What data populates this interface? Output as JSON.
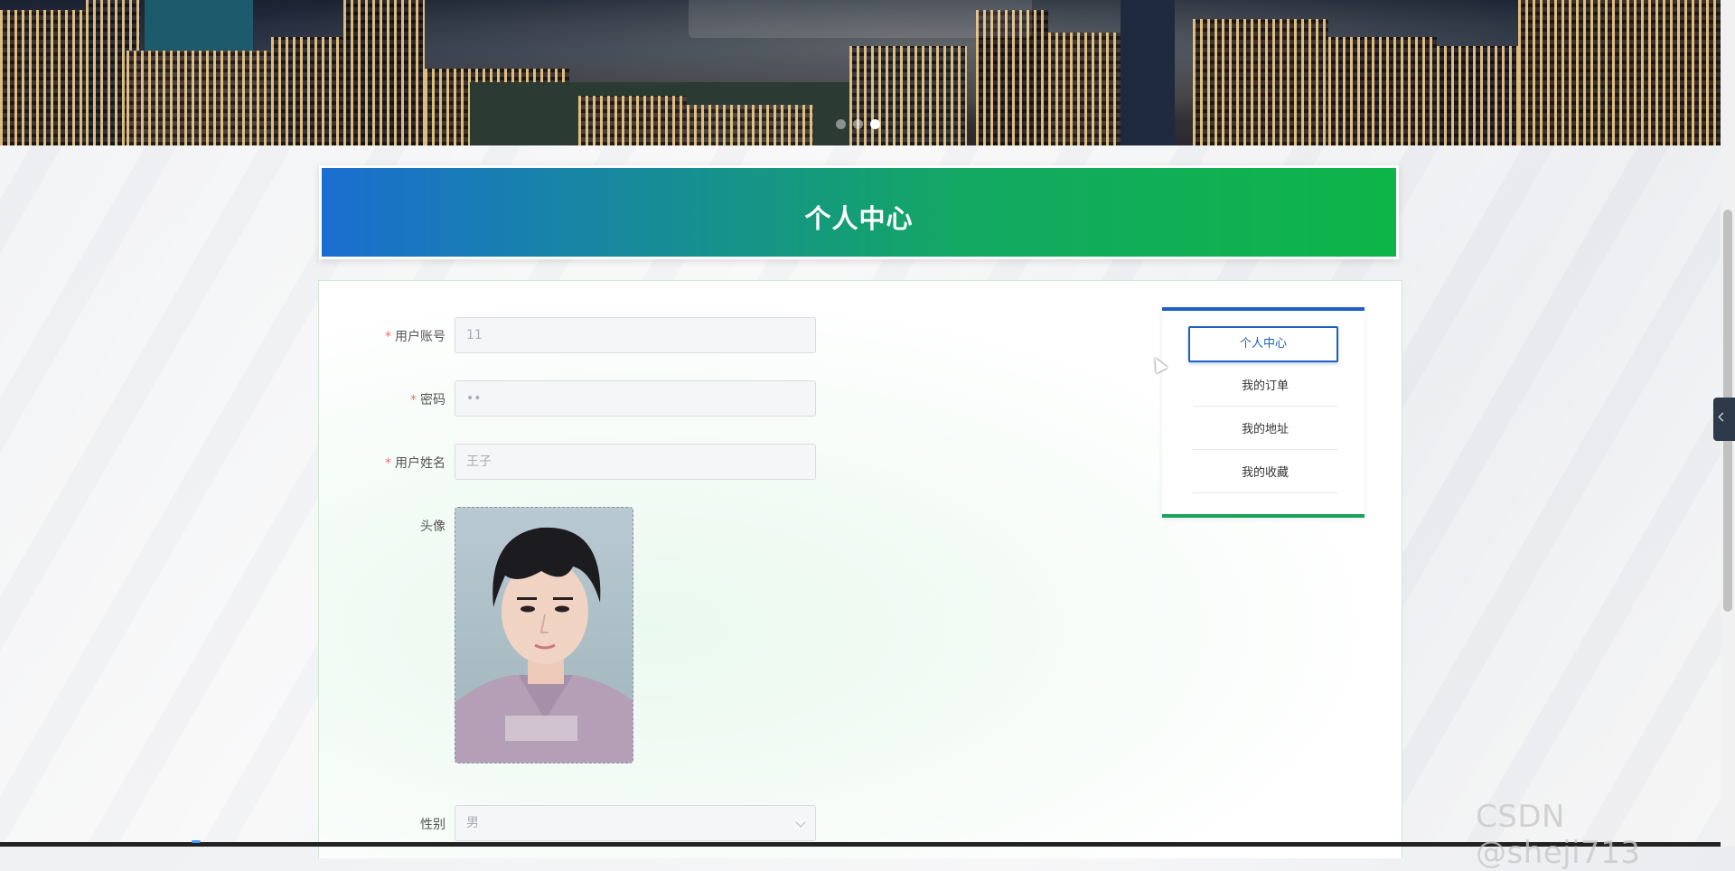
{
  "banner": {
    "chip_text": "",
    "slides": 3,
    "active_slide": 3
  },
  "page_title": "个人中心",
  "form": {
    "account": {
      "label": "用户账号",
      "required": true,
      "value": "11"
    },
    "password": {
      "label": "密码",
      "required": true,
      "value": "••"
    },
    "name": {
      "label": "用户姓名",
      "required": true,
      "value": "王子"
    },
    "avatar": {
      "label": "头像"
    },
    "gender": {
      "label": "性别",
      "value": "男"
    }
  },
  "menu": {
    "items": [
      {
        "label": "个人中心",
        "active": true
      },
      {
        "label": "我的订单",
        "active": false
      },
      {
        "label": "我的地址",
        "active": false
      },
      {
        "label": "我的收藏",
        "active": false
      }
    ]
  },
  "watermark": "CSDN @sheji713",
  "colors": {
    "header_gradient_start": "#1a6ed0",
    "header_gradient_end": "#0db548",
    "menu_accent_blue": "#1f5fbf",
    "menu_accent_green": "#18a35a",
    "required_star": "#f56c6c"
  },
  "icons": {
    "select_arrow": "chevron-down-icon",
    "side_toggle": "chevron-left-icon"
  }
}
